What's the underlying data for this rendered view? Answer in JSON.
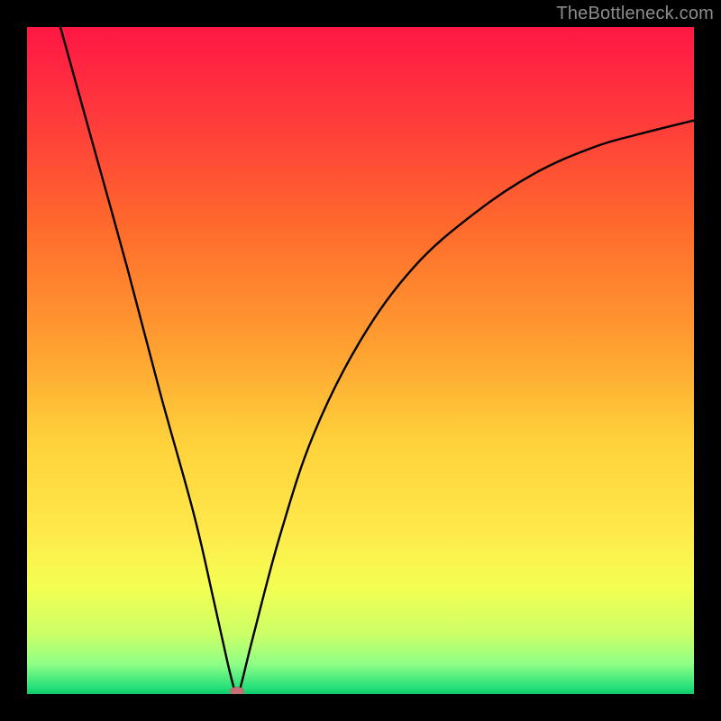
{
  "watermark": "TheBottleneck.com",
  "colors": {
    "background": "#000000",
    "gradient_stops": [
      {
        "pos": 0.0,
        "color": "#ff1744"
      },
      {
        "pos": 0.14,
        "color": "#ff3b3b"
      },
      {
        "pos": 0.3,
        "color": "#ff6a2c"
      },
      {
        "pos": 0.48,
        "color": "#ffa031"
      },
      {
        "pos": 0.62,
        "color": "#ffd13a"
      },
      {
        "pos": 0.75,
        "color": "#ffe84a"
      },
      {
        "pos": 0.84,
        "color": "#f4ff52"
      },
      {
        "pos": 0.91,
        "color": "#ccff66"
      },
      {
        "pos": 0.955,
        "color": "#8fff86"
      },
      {
        "pos": 0.99,
        "color": "#27e07a"
      },
      {
        "pos": 1.0,
        "color": "#0ecb6a"
      }
    ],
    "curve_stroke": "#000000",
    "marker_fill": "#c76f75"
  },
  "chart_data": {
    "type": "line",
    "title": "",
    "xlabel": "",
    "ylabel": "",
    "xlim": [
      0,
      100
    ],
    "ylim": [
      0,
      100
    ],
    "series": [
      {
        "name": "bottleneck-curve",
        "points": [
          {
            "x": 5,
            "y": 100
          },
          {
            "x": 10,
            "y": 82
          },
          {
            "x": 15,
            "y": 64
          },
          {
            "x": 20,
            "y": 45
          },
          {
            "x": 25,
            "y": 27
          },
          {
            "x": 28,
            "y": 14
          },
          {
            "x": 30,
            "y": 5
          },
          {
            "x": 31,
            "y": 1
          },
          {
            "x": 31.5,
            "y": 0
          },
          {
            "x": 32,
            "y": 1
          },
          {
            "x": 34,
            "y": 9
          },
          {
            "x": 38,
            "y": 24
          },
          {
            "x": 43,
            "y": 39
          },
          {
            "x": 50,
            "y": 53
          },
          {
            "x": 58,
            "y": 64
          },
          {
            "x": 67,
            "y": 72
          },
          {
            "x": 76,
            "y": 78
          },
          {
            "x": 85,
            "y": 82
          },
          {
            "x": 92,
            "y": 84
          },
          {
            "x": 100,
            "y": 86
          }
        ]
      }
    ],
    "annotations": [
      {
        "name": "optimal-marker",
        "x": 31.5,
        "y": 0
      }
    ]
  }
}
